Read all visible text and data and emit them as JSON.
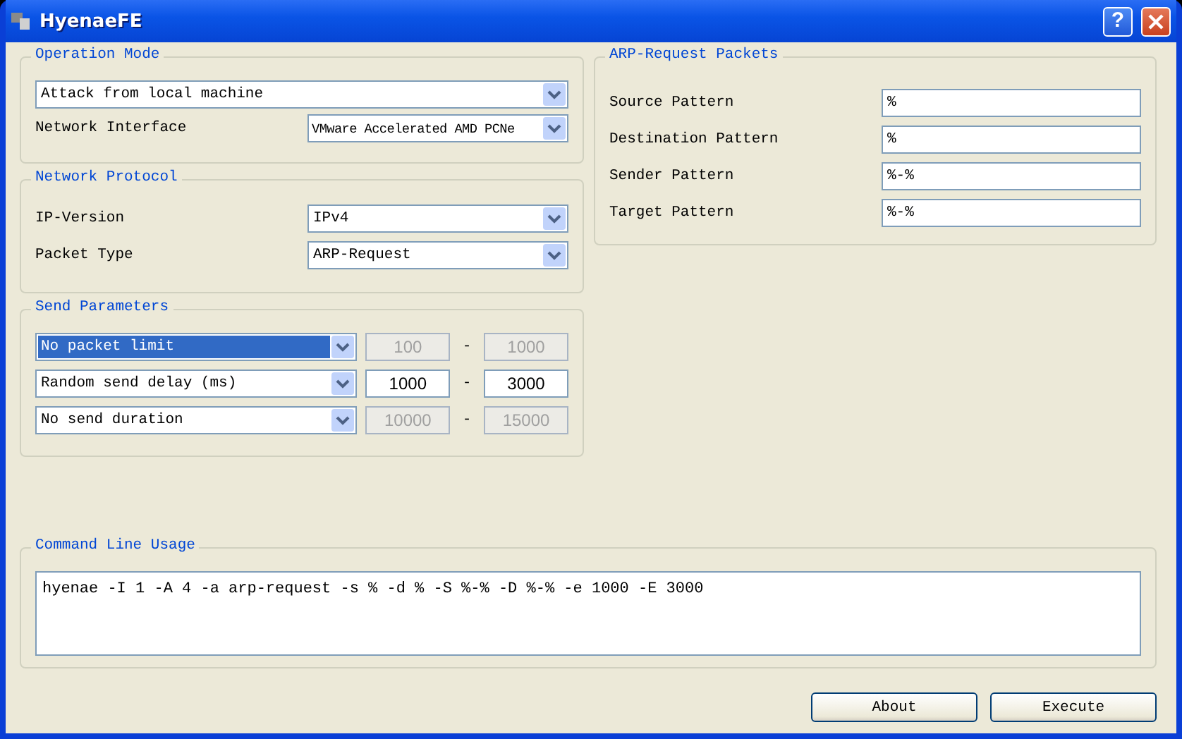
{
  "window": {
    "title": "HyenaeFE",
    "help_button": "?"
  },
  "operation_mode": {
    "title": "Operation Mode",
    "mode": "Attack from local machine",
    "interface_label": "Network Interface",
    "interface": "VMware Accelerated AMD PCNe"
  },
  "network_protocol": {
    "title": "Network Protocol",
    "fields": [
      {
        "label": "IP-Version",
        "value": "IPv4"
      },
      {
        "label": "Packet Type",
        "value": "ARP-Request"
      }
    ]
  },
  "send_parameters": {
    "title": "Send Parameters",
    "rows": [
      {
        "mode": "No packet limit",
        "selected": true,
        "from": "100",
        "separator": "-",
        "to": "1000",
        "disabled": true
      },
      {
        "mode": "Random send delay (ms)",
        "selected": false,
        "from": "1000",
        "separator": "-",
        "to": "3000",
        "disabled": false
      },
      {
        "mode": "No send duration",
        "selected": false,
        "from": "10000",
        "separator": "-",
        "to": "15000",
        "disabled": true
      }
    ]
  },
  "arp_packets": {
    "title": "ARP-Request Packets",
    "fields": [
      {
        "label": "Source Pattern",
        "value": "%"
      },
      {
        "label": "Destination Pattern",
        "value": "%"
      },
      {
        "label": "Sender Pattern",
        "value": "%-%"
      },
      {
        "label": "Target Pattern",
        "value": "%-%"
      }
    ]
  },
  "command_line": {
    "title": "Command Line Usage",
    "value": "hyenae -I 1 -A 4 -a arp-request -s % -d % -S %-% -D %-% -e 1000 -E 3000"
  },
  "buttons": [
    "About",
    "Execute"
  ]
}
